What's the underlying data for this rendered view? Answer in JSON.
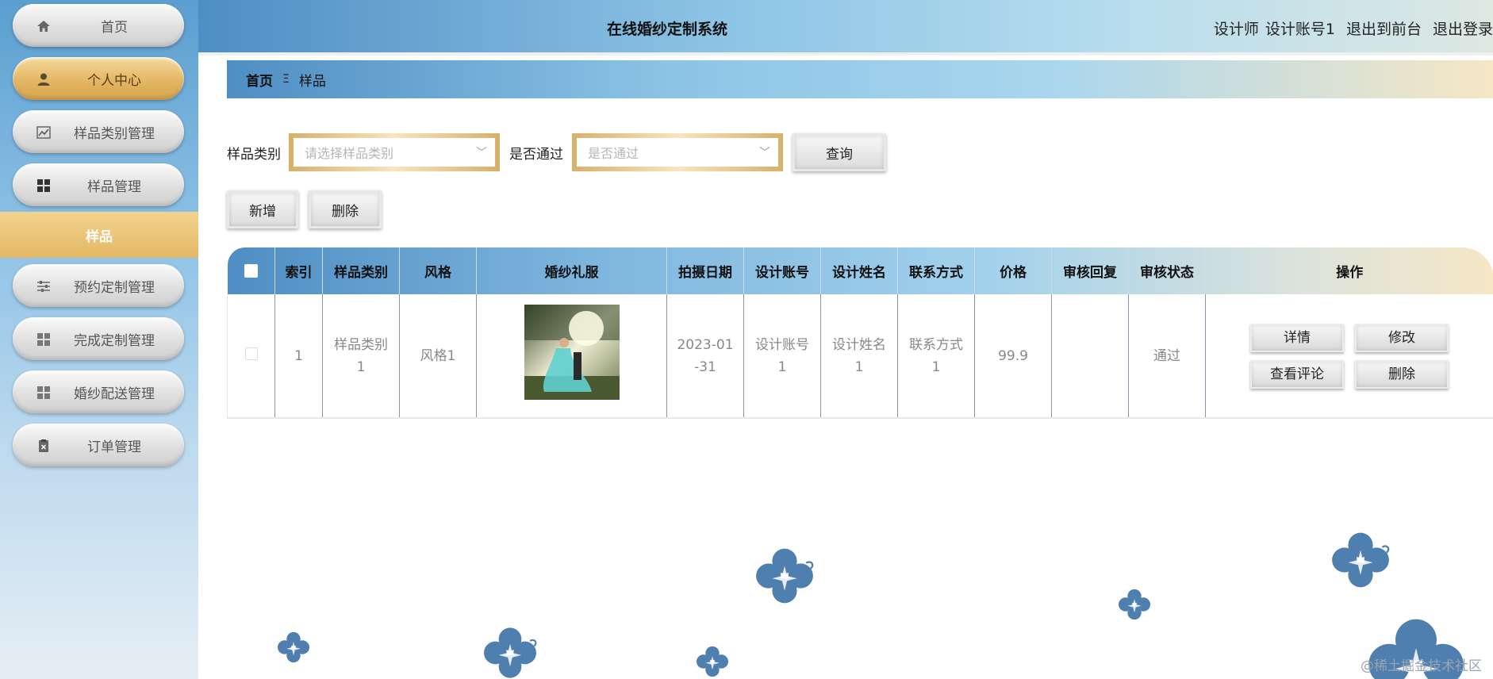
{
  "app": {
    "title": "在线婚纱定制系统"
  },
  "header": {
    "role": "设计师",
    "username": "设计账号1",
    "front_link": "退出到前台",
    "logout_link": "退出登录"
  },
  "sidebar": {
    "items": [
      {
        "label": "首页",
        "icon": "home-icon"
      },
      {
        "label": "个人中心",
        "icon": "user-icon"
      },
      {
        "label": "样品类别管理",
        "icon": "chart-icon"
      },
      {
        "label": "样品管理",
        "icon": "grid-icon"
      },
      {
        "label": "预约定制管理",
        "icon": "sliders-icon"
      },
      {
        "label": "完成定制管理",
        "icon": "grid-icon"
      },
      {
        "label": "婚纱配送管理",
        "icon": "grid-icon"
      },
      {
        "label": "订单管理",
        "icon": "clipboard-icon"
      }
    ],
    "submenu_active": "样品"
  },
  "breadcrumb": {
    "home": "首页",
    "separator": "Ξ",
    "current": "样品"
  },
  "search": {
    "category_label": "样品类别",
    "category_placeholder": "请选择样品类别",
    "approved_label": "是否通过",
    "approved_placeholder": "是否通过",
    "query_button": "查询"
  },
  "actions": {
    "add": "新增",
    "delete": "删除"
  },
  "table": {
    "columns": [
      "索引",
      "样品类别",
      "风格",
      "婚纱礼服",
      "拍摄日期",
      "设计账号",
      "设计姓名",
      "联系方式",
      "价格",
      "审核回复",
      "审核状态",
      "操作"
    ],
    "rows": [
      {
        "index": "1",
        "category": [
          "样品类别",
          "1"
        ],
        "style": "风格1",
        "date": [
          "2023-01",
          "-31"
        ],
        "account": [
          "设计账号",
          "1"
        ],
        "name": [
          "设计姓名",
          "1"
        ],
        "contact": [
          "联系方式",
          "1"
        ],
        "price": "99.9",
        "reply": "",
        "status": "通过",
        "ops": {
          "detail": "详情",
          "edit": "修改",
          "comments": "查看评论",
          "delete": "删除"
        }
      }
    ]
  },
  "colors": {
    "accent_blue": "#5b9ed0",
    "gold": "#e3b765",
    "flower": "#4f7fae"
  },
  "watermark": "@稀土掘金技术社区"
}
